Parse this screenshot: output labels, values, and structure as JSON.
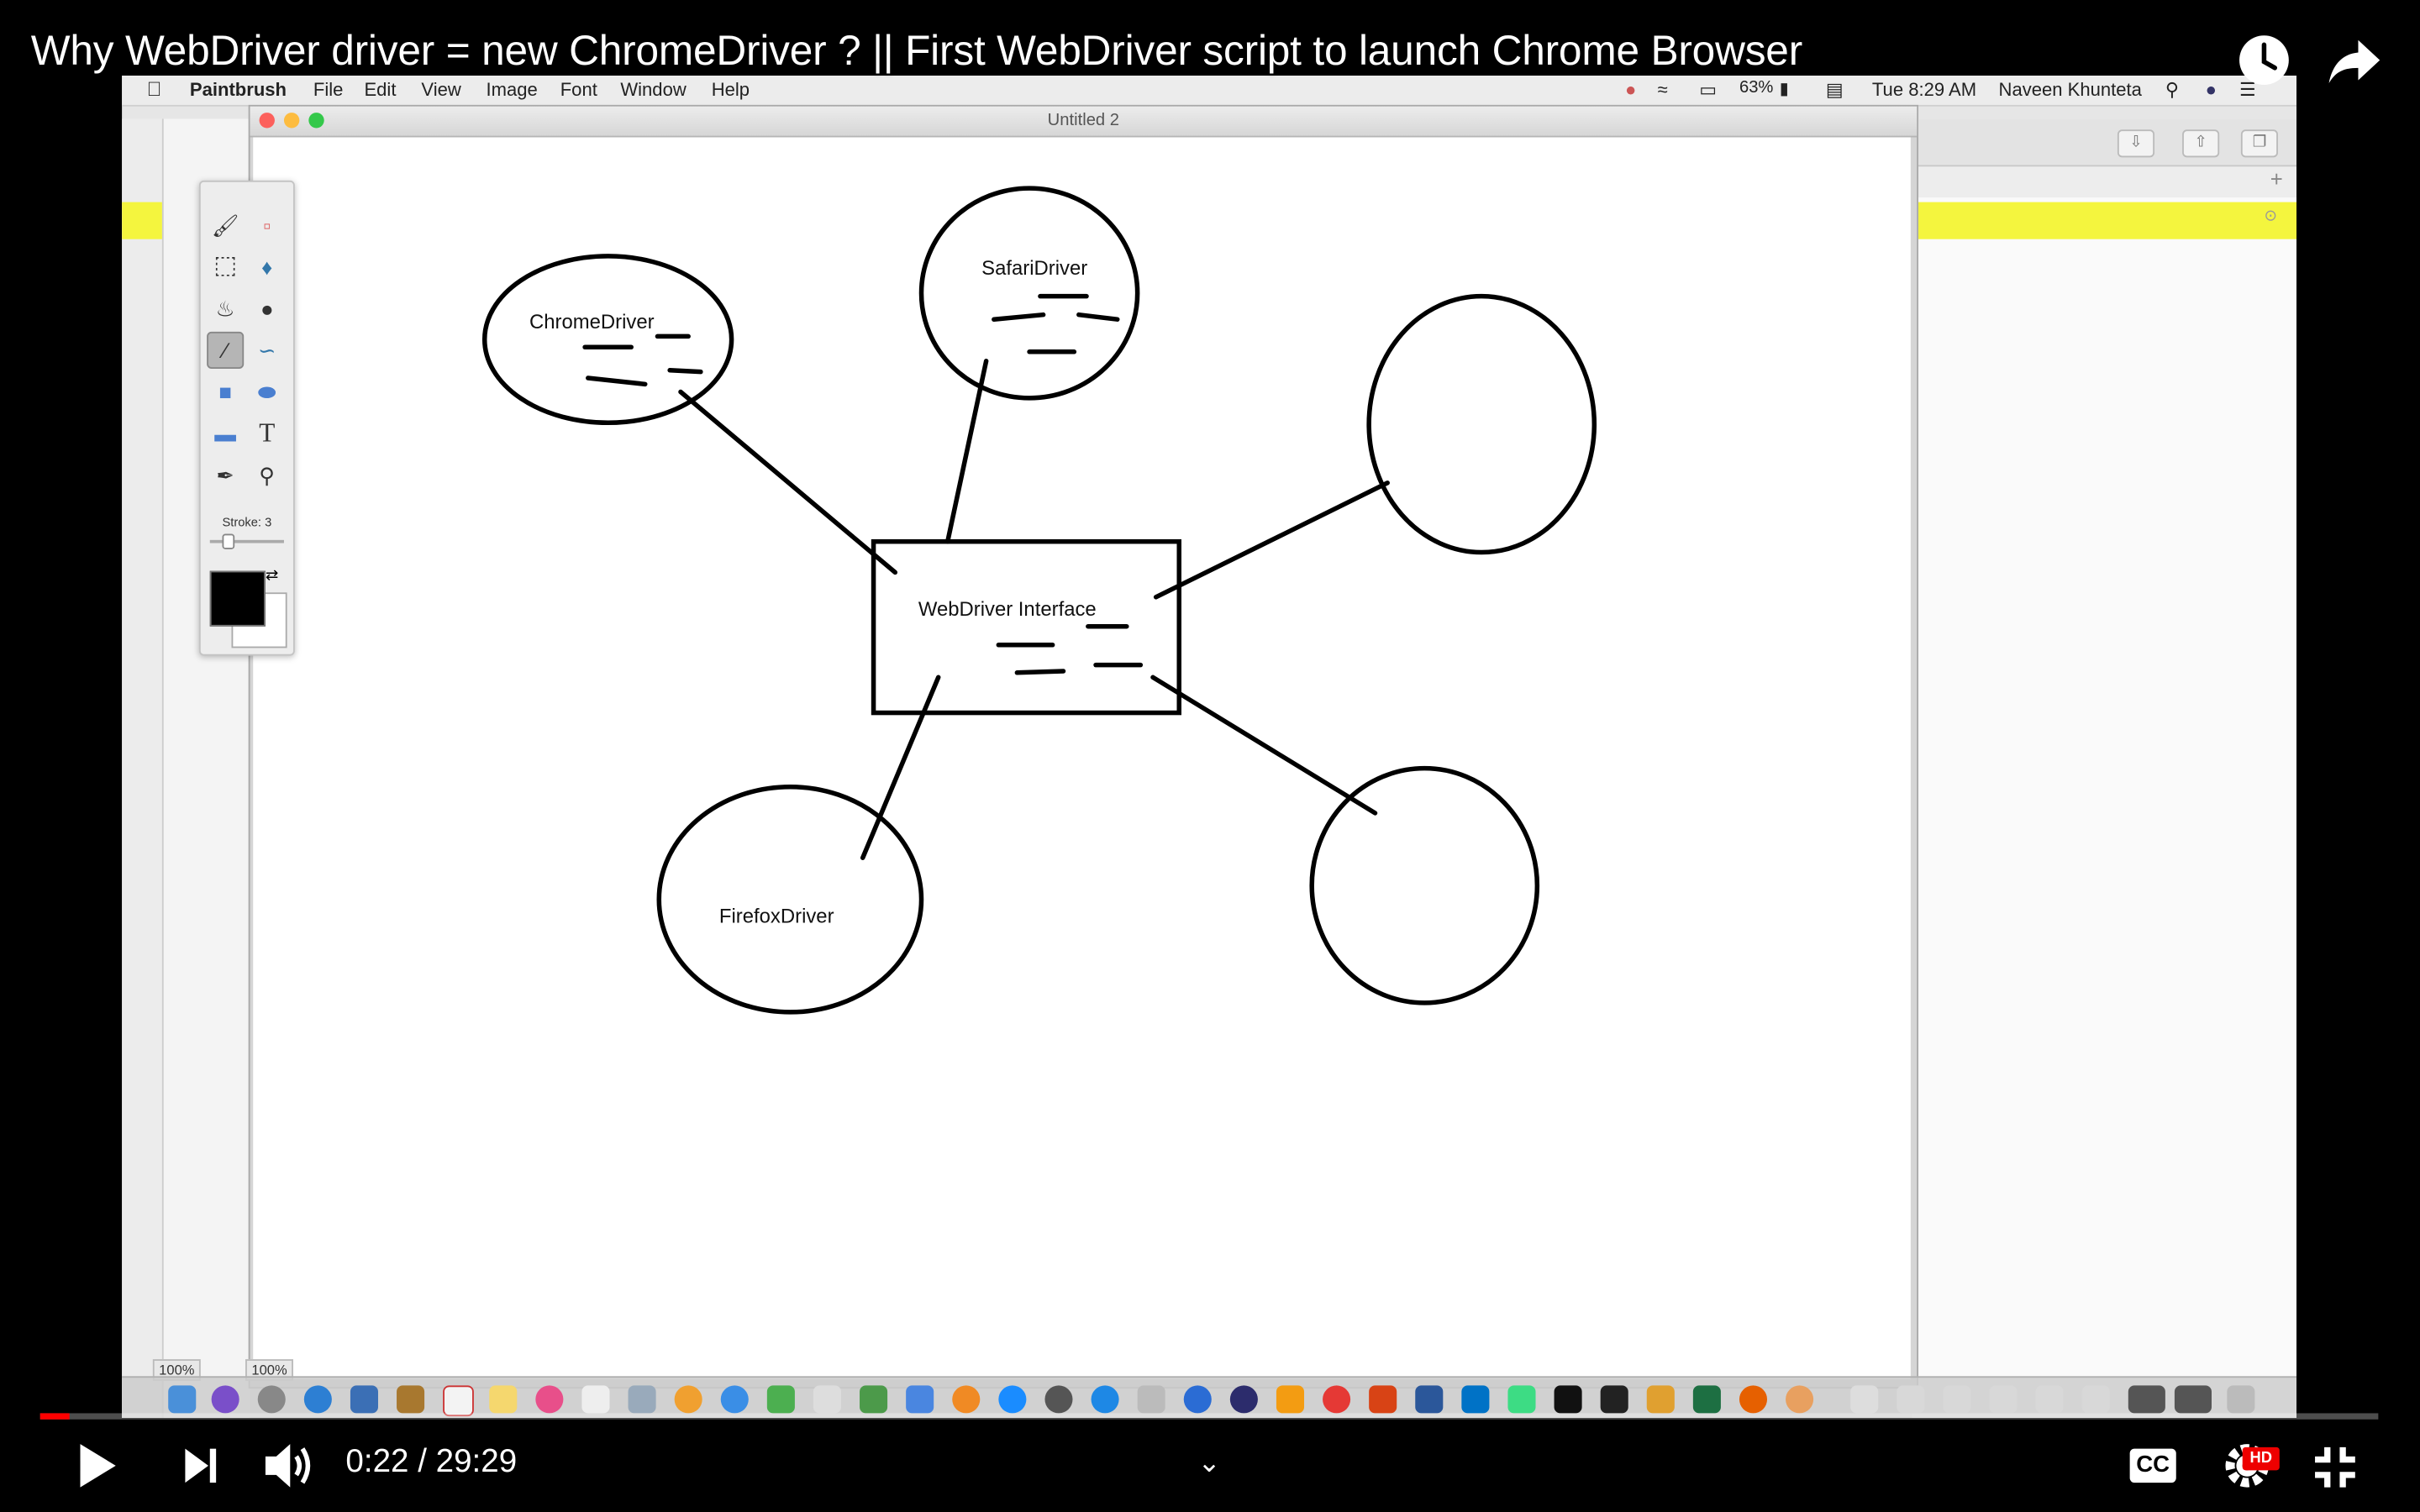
{
  "video": {
    "title": "Why WebDriver driver = new ChromeDriver ? || First WebDriver script to launch Chrome Browser",
    "current_time": "0:22",
    "duration": "29:29",
    "time_display": "0:22 / 29:29",
    "progress_fraction": 0.0124,
    "hd_badge": "HD",
    "cc_label": "CC"
  },
  "menubar": {
    "app_name": "Paintbrush",
    "menus": [
      "File",
      "Edit",
      "View",
      "Image",
      "Font",
      "Window",
      "Help"
    ],
    "battery": "63%",
    "clock": "Tue 8:29 AM",
    "user": "Naveen Khunteta"
  },
  "window": {
    "title": "Untitled 2",
    "zoom_left": "100%",
    "zoom_right": "100%"
  },
  "palette": {
    "stroke_label": "Stroke: 3",
    "tools": [
      "brush-icon",
      "eraser-icon",
      "select-rect-icon",
      "paint-bucket-icon",
      "spray-icon",
      "bomb-icon",
      "line-icon",
      "curve-icon",
      "rectangle-icon",
      "ellipse-icon",
      "rounded-rect-icon",
      "text-icon",
      "eyedropper-icon",
      "magnifier-icon"
    ],
    "text_tool_glyph": "T",
    "foreground_color": "#000000",
    "background_color": "#ffffff"
  },
  "diagram": {
    "center_box": "WebDriver Interface",
    "nodes": {
      "chrome": "ChromeDriver",
      "safari": "SafariDriver",
      "firefox": "FirefoxDriver",
      "empty_top_right": "",
      "empty_bottom_right": ""
    }
  },
  "colors": {
    "progress": "#ff0000",
    "highlight_yellow": "#f4f53e",
    "close_light": "#fc605c",
    "min_light": "#fdbc40",
    "max_light": "#34c84a"
  }
}
